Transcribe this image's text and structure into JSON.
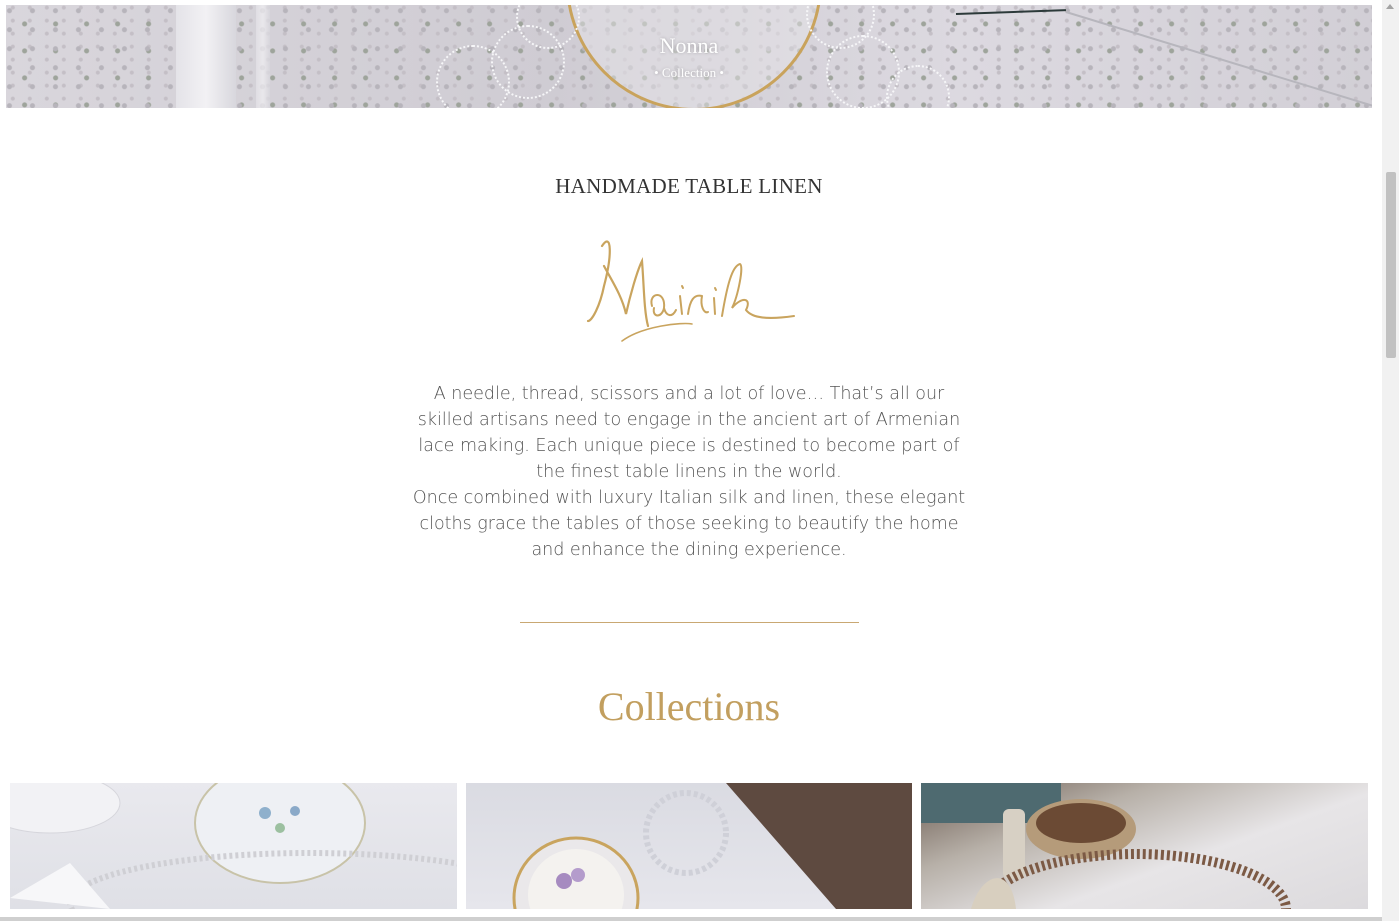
{
  "hero": {
    "title": "Nonna",
    "subtitle": "• Collection •"
  },
  "intro": {
    "heading": "HANDMADE TABLE LINEN",
    "logo_text": "Mairik",
    "paragraph1": "A needle, thread, scissors and a lot of love… That’s all our skilled artisans need to engage in the ancient art of Armenian lace making. Each unique piece is destined to become part of the finest table linens in the world.",
    "paragraph2": "Once combined with luxury Italian silk and linen, these elegant cloths grace the tables of those seeking to beautify the home and enhance the dining experience."
  },
  "collections": {
    "heading": "Collections",
    "cards": [
      {
        "image": "teacup-on-white-lace"
      },
      {
        "image": "porcelain-cup-on-lace-tablecloth"
      },
      {
        "image": "lace-doily-with-wooden-bowl"
      }
    ]
  },
  "colors": {
    "accent": "#c29f5f",
    "text": "#555555"
  }
}
